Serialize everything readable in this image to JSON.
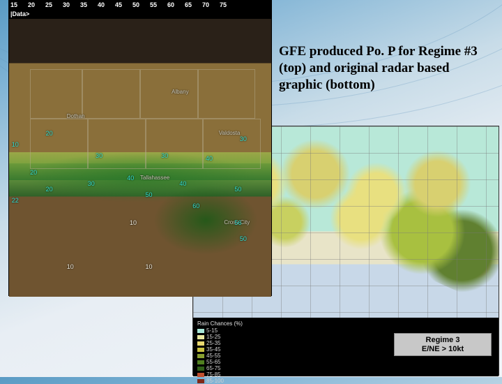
{
  "caption": "GFE produced Po. P for Regime #3 (top) and original radar based graphic (bottom)",
  "top_map": {
    "ruler": [
      "15",
      "20",
      "25",
      "30",
      "35",
      "40",
      "45",
      "50",
      "55",
      "60",
      "65",
      "70",
      "75"
    ],
    "header": "|Data>",
    "cities": {
      "albany": "Albany",
      "dothan": "Dothan",
      "valdosta": "Valdosta",
      "tallahassee": "Tallahassee",
      "cross_city": "Cross City"
    },
    "contours": {
      "v10a": "10",
      "v10b": "10",
      "v10c": "10",
      "v20a": "20",
      "v20b": "20",
      "v20c": "20",
      "v22": "22",
      "v30a": "30",
      "v30b": "30",
      "v30c": "30",
      "v30d": "30",
      "v40a": "40",
      "v40b": "40",
      "v40c": "40",
      "v50a": "50",
      "v50b": "50",
      "v50c": "50",
      "v56": "56",
      "v60": "60"
    }
  },
  "bottom_map": {
    "legend_title": "Rain Chances (%)",
    "legend_items": [
      {
        "label": "5-15",
        "color": "#a8e8d8"
      },
      {
        "label": "15-25",
        "color": "#e8e8a0"
      },
      {
        "label": "25-35",
        "color": "#e8d870"
      },
      {
        "label": "35-45",
        "color": "#c8c040"
      },
      {
        "label": "45-55",
        "color": "#88a030"
      },
      {
        "label": "55-65",
        "color": "#508020"
      },
      {
        "label": "65-75",
        "color": "#306018"
      },
      {
        "label": "75-85",
        "color": "#c05030"
      },
      {
        "label": "85-100",
        "color": "#802818"
      }
    ],
    "regime_line1": "Regime 3",
    "regime_line2": "E/NE > 10kt"
  }
}
